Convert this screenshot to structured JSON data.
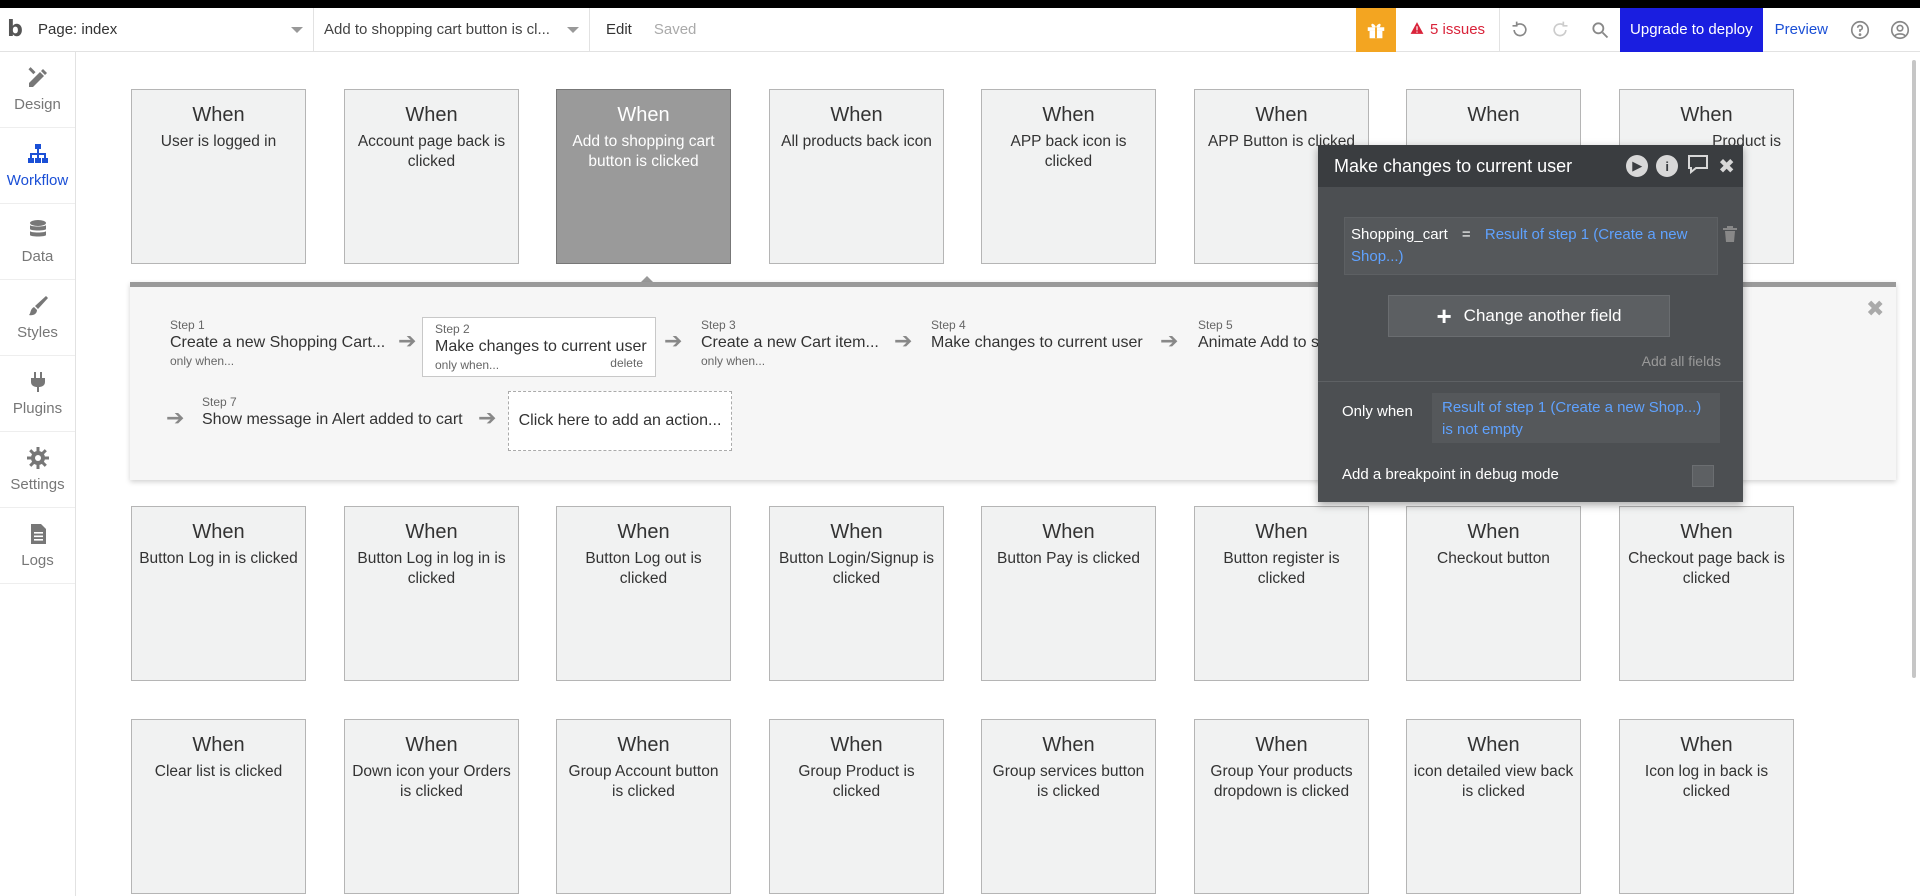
{
  "topbar": {
    "logo": "b",
    "page_label": "Page: index",
    "event_label": "Add to shopping cart button is cl...",
    "edit_label": "Edit",
    "saved_label": "Saved",
    "issues_label": "5 issues",
    "upgrade_label": "Upgrade to deploy",
    "preview_label": "Preview",
    "accent_color": "#1a1ee0",
    "gift_color": "#f3a521",
    "issues_color": "#d9233a"
  },
  "nav": {
    "items": [
      {
        "label": "Design",
        "icon": "design-pencil-ruler-icon"
      },
      {
        "label": "Workflow",
        "icon": "workflow-sitemap-icon",
        "active": true
      },
      {
        "label": "Data",
        "icon": "database-icon"
      },
      {
        "label": "Styles",
        "icon": "brush-icon"
      },
      {
        "label": "Plugins",
        "icon": "plug-icon"
      },
      {
        "label": "Settings",
        "icon": "gear-icon"
      },
      {
        "label": "Logs",
        "icon": "document-icon"
      }
    ]
  },
  "events": {
    "when": "When",
    "row1": [
      "User is logged in",
      "Account page back is clicked",
      "Add to shopping cart button is clicked",
      "All products back icon",
      "APP back icon is clicked",
      "APP Button is clicked",
      "",
      "Product is"
    ],
    "row2": [
      "Button Log in is clicked",
      "Button Log in log in is clicked",
      "Button Log out is clicked",
      "Button Login/Signup is clicked",
      "Button Pay is clicked",
      "Button register is clicked",
      "Checkout button",
      "Checkout page back is clicked"
    ],
    "row3": [
      "Clear list is clicked",
      "Down icon your Orders is clicked",
      "Group Account button is clicked",
      "Group Product is clicked",
      "Group services button is clicked",
      "Group Your products dropdown is clicked",
      "icon detailed view back is clicked",
      "Icon log in back is clicked"
    ]
  },
  "steps": [
    {
      "num": "Step 1",
      "title": "Create a new Shopping Cart...",
      "cond": "only when..."
    },
    {
      "num": "Step 2",
      "title": "Make changes to current user",
      "cond": "only when...",
      "delete": "delete"
    },
    {
      "num": "Step 3",
      "title": "Create a new Cart item...",
      "cond": "only when..."
    },
    {
      "num": "Step 4",
      "title": "Make changes to current user",
      "cond": ""
    },
    {
      "num": "Step 5",
      "title": "Animate Add to s",
      "cond": ""
    },
    {
      "num": "Step 7",
      "title": "Show message in Alert added to cart",
      "cond": ""
    }
  ],
  "add_action_label": "Click here to add an action...",
  "editor": {
    "title": "Make changes to current user",
    "field_name": "Shopping_cart",
    "field_op": "=",
    "field_value": "Result of step 1 (Create a new Shop...)",
    "change_another": "Change another field",
    "add_all_fields": "Add all fields",
    "only_when_label": "Only when",
    "only_when_value": "Result of step 1 (Create a new Shop...) is not empty",
    "breakpoint_label": "Add a breakpoint in debug mode"
  }
}
